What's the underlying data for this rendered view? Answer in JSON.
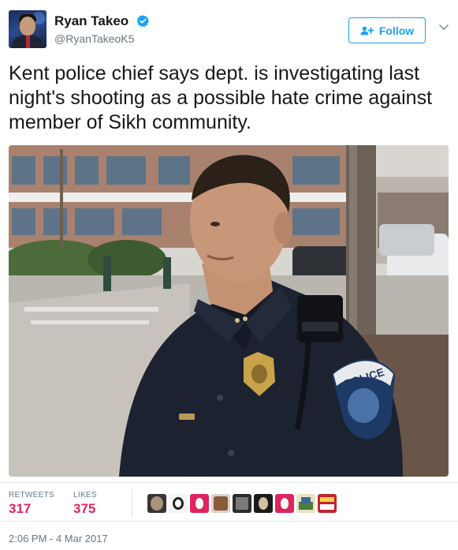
{
  "user": {
    "name": "Ryan Takeo",
    "handle": "@RyanTakeoK5",
    "verified": true
  },
  "follow_button": {
    "label": "Follow"
  },
  "tweet": {
    "text": "Kent police chief says dept. is investigating last night's shooting as a possible hate crime against member of Sikh community.",
    "photo_description_icon": "photo-police-chief"
  },
  "stats": {
    "retweets_label": "RETWEETS",
    "retweets_count": "317",
    "likes_label": "LIKES",
    "likes_count": "375"
  },
  "timestamp": "2:06 PM - 4 Mar 2017",
  "colors": {
    "accent": "#1da1f2",
    "stat_number": "#e0245e",
    "muted": "#657786"
  }
}
